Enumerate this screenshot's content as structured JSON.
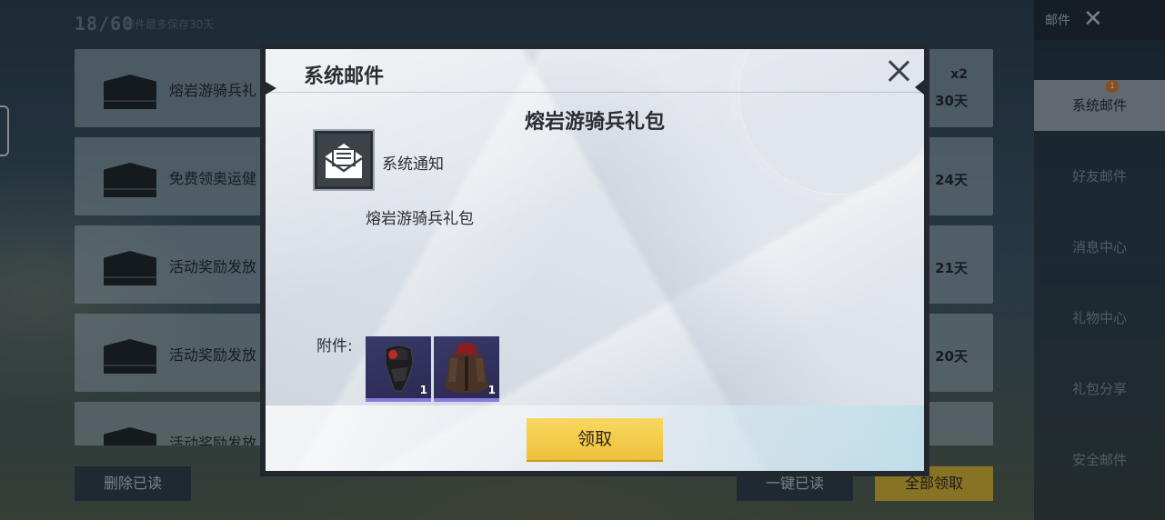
{
  "background": {
    "counter": "18/60",
    "note": "邮件最多保存30天",
    "mails": [
      {
        "title": "熔岩游骑兵礼",
        "count": "x2",
        "days": "30天"
      },
      {
        "title": "免费领奥运健",
        "count": "",
        "days": "24天"
      },
      {
        "title": "活动奖励发放",
        "count": "",
        "days": "21天"
      },
      {
        "title": "活动奖励发放",
        "count": "",
        "days": "20天"
      },
      {
        "title": "活动奖励发放",
        "count": "",
        "days": ""
      }
    ],
    "buttons": {
      "delete_read": "删除已读",
      "read_all": "一键已读",
      "claim_all": "全部领取"
    },
    "side_header": {
      "label": "邮件",
      "close_icon": "close-icon"
    },
    "side_tabs": [
      {
        "label": "系统邮件",
        "badge": "1"
      },
      {
        "label": "好友邮件"
      },
      {
        "label": "消息中心"
      },
      {
        "label": "礼物中心"
      },
      {
        "label": "礼包分享"
      },
      {
        "label": "安全邮件"
      }
    ]
  },
  "modal": {
    "title": "系统邮件",
    "close_icon": "close-icon",
    "heading": "熔岩游骑兵礼包",
    "sender_icon": "mail-envelope-icon",
    "sender": "系统通知",
    "body": "熔岩游骑兵礼包",
    "attachments_label": "附件:",
    "attachments": [
      {
        "icon": "helmet-icon",
        "qty": "1"
      },
      {
        "icon": "jacket-icon",
        "qty": "1"
      }
    ],
    "claim_button": "领取"
  },
  "colors": {
    "accent_yellow": "#eec03a",
    "modal_frame": "#22282e",
    "item_rarity": "#8a7ae0",
    "badge": "#e87a20"
  }
}
